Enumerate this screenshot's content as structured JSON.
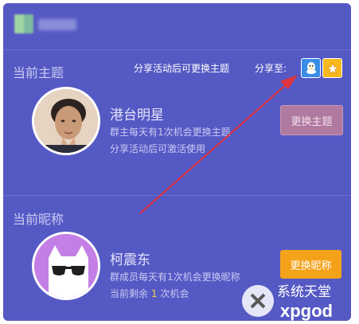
{
  "header": {
    "username_blurred": ""
  },
  "theme_section": {
    "title": "当前主题",
    "share_hint": "分享活动后可更换主题",
    "share_to_label": "分享至:",
    "theme_name": "港台明星",
    "desc_line1": "群主每天有1次机会更换主题",
    "desc_line2": "分享活动后可激活使用",
    "change_button": "更换主题"
  },
  "nickname_section": {
    "title": "当前昵称",
    "nickname": "柯震东",
    "desc_line1": "群成员每天有1次机会更换昵称",
    "remaining_prefix": "当前剩余",
    "remaining_count": "1",
    "remaining_suffix": "次机会",
    "change_button": "更换昵称"
  },
  "watermark": {
    "cn_text": "系统天堂",
    "en_text": "xpgod"
  },
  "colors": {
    "panel_bg": "#5559c4",
    "accent_orange": "#f5a21b",
    "qq_blue": "#3a8ce6",
    "arrow_red": "#e2343c"
  },
  "icons": {
    "share_qq": "qq-penguin-icon",
    "share_favorite": "star-icon"
  }
}
